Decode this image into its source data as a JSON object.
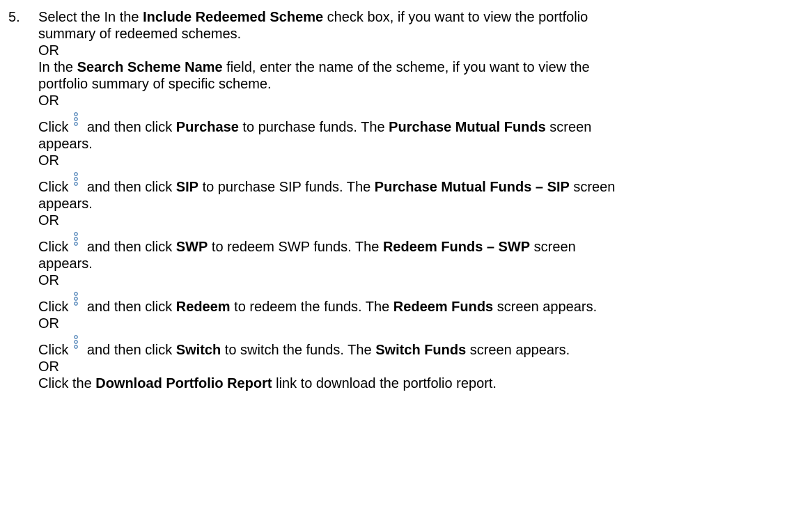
{
  "step": {
    "number": "5.",
    "p1": {
      "a": "Select the In the ",
      "b": "Include Redeemed Scheme",
      "c": " check box, if you want to view the portfolio",
      "line2": "summary of redeemed schemes."
    },
    "or_label": "OR",
    "p2": {
      "a": "In the ",
      "b": "Search Scheme Name",
      "c": " field, enter the name of the scheme, if you want to view the",
      "line2": "portfolio summary of specific scheme."
    },
    "p3": {
      "click": "Click",
      "a": " and then click ",
      "b": "Purchase",
      "c": " to purchase funds. The ",
      "d": "Purchase Mutual Funds",
      "e": " screen",
      "line2": "appears."
    },
    "p4": {
      "click": "Click",
      "a": " and then click ",
      "b": "SIP",
      "c": " to purchase SIP funds. The ",
      "d": "Purchase Mutual Funds – SIP",
      "e": " screen",
      "line2": "appears."
    },
    "p5": {
      "click": "Click",
      "a": " and then click ",
      "b": "SWP",
      "c": " to redeem SWP funds. The ",
      "d": "Redeem Funds – SWP",
      "e": " screen",
      "line2": "appears."
    },
    "p6": {
      "click": "Click",
      "a": " and then click ",
      "b": "Redeem",
      "c": " to redeem the funds. The ",
      "d": "Redeem Funds",
      "e": " screen appears."
    },
    "p7": {
      "click": "Click",
      "a": " and then click ",
      "b": "Switch",
      "c": " to switch the funds. The ",
      "d": "Switch Funds",
      "e": " screen appears."
    },
    "p8": {
      "a": "Click the ",
      "b": "Download Portfolio Report",
      "c": " link to download the portfolio report."
    }
  },
  "icons": {
    "kebab": "vertical-ellipsis-icon",
    "kebab_color": "#4a7fb5"
  }
}
